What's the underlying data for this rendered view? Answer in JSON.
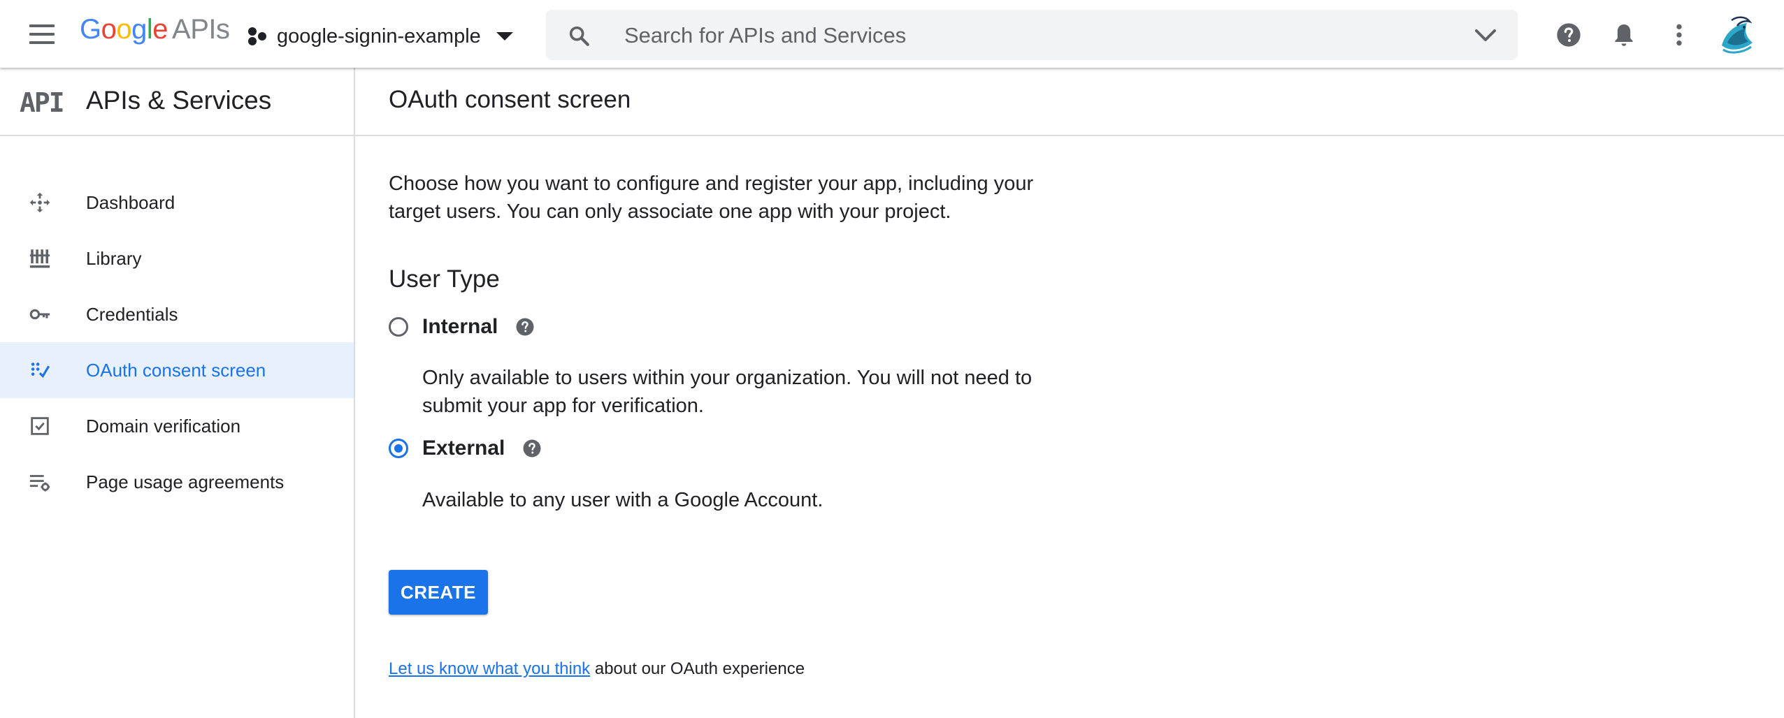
{
  "brand": {
    "logo_word": "Google",
    "logo_suffix": "APIs"
  },
  "project": {
    "name": "google-signin-example"
  },
  "search": {
    "placeholder": "Search for APIs and Services"
  },
  "topbar_icons": [
    "menu-icon",
    "project-dots-icon",
    "search-icon",
    "chevron-down-icon",
    "help-icon",
    "bell-icon",
    "more-vert-icon",
    "avatar"
  ],
  "sidebar": {
    "mark": "API",
    "title": "APIs & Services",
    "items": [
      {
        "label": "Dashboard",
        "icon": "dashboard-icon",
        "active": false
      },
      {
        "label": "Library",
        "icon": "library-icon",
        "active": false
      },
      {
        "label": "Credentials",
        "icon": "key-icon",
        "active": false
      },
      {
        "label": "OAuth consent screen",
        "icon": "consent-icon",
        "active": true
      },
      {
        "label": "Domain verification",
        "icon": "checkbox-icon",
        "active": false
      },
      {
        "label": "Page usage agreements",
        "icon": "settings-list-icon",
        "active": false
      }
    ]
  },
  "main": {
    "title": "OAuth consent screen",
    "description": "Choose how you want to configure and register your app, including your target users. You can only associate one app with your project.",
    "user_type_title": "User Type",
    "options": [
      {
        "label": "Internal",
        "description": "Only available to users within your organization. You will not need to submit your app for verification.",
        "checked": false
      },
      {
        "label": "External",
        "description": "Available to any user with a Google Account.",
        "checked": true
      }
    ],
    "create_label": "CREATE",
    "feedback_link": "Let us know what you think",
    "feedback_text": " about our OAuth experience"
  },
  "colors": {
    "accent": "#1a73e8",
    "active_bg": "#e8f0fe",
    "icon_gray": "#5f6368",
    "divider": "#dadce0"
  }
}
